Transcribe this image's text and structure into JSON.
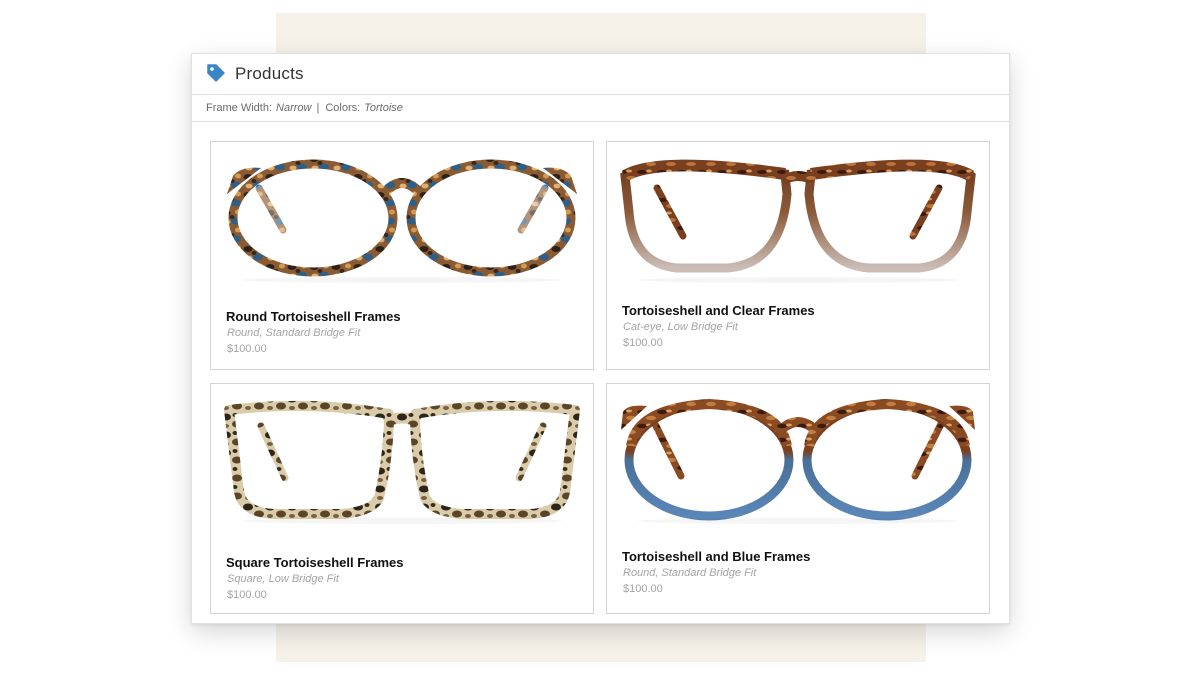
{
  "header": {
    "title": "Products",
    "icon": "tag-icon",
    "icon_color": "#3b86c6"
  },
  "filters": {
    "frame_width_label": "Frame Width:",
    "frame_width_value": "Narrow",
    "separator": "|",
    "colors_label": "Colors:",
    "colors_value": "Tortoise"
  },
  "products": [
    {
      "name": "Round Tortoiseshell Frames",
      "description": "Round, Standard Bridge Fit",
      "price": "$100.00",
      "image": "round tortoise-and-blue eyeglasses"
    },
    {
      "name": "Tortoiseshell and Clear Frames",
      "description": "Cat-eye, Low Bridge Fit",
      "price": "$100.00",
      "image": "cat-eye tortoise fading to clear eyeglasses"
    },
    {
      "name": "Square Tortoiseshell Frames",
      "description": "Square, Low Bridge Fit",
      "price": "$100.00",
      "image": "square light tortoise eyeglasses"
    },
    {
      "name": "Tortoiseshell and Blue Frames",
      "description": "Round, Standard Bridge Fit",
      "price": "$100.00",
      "image": "round tortoise top with blue bottom eyeglasses"
    }
  ]
}
